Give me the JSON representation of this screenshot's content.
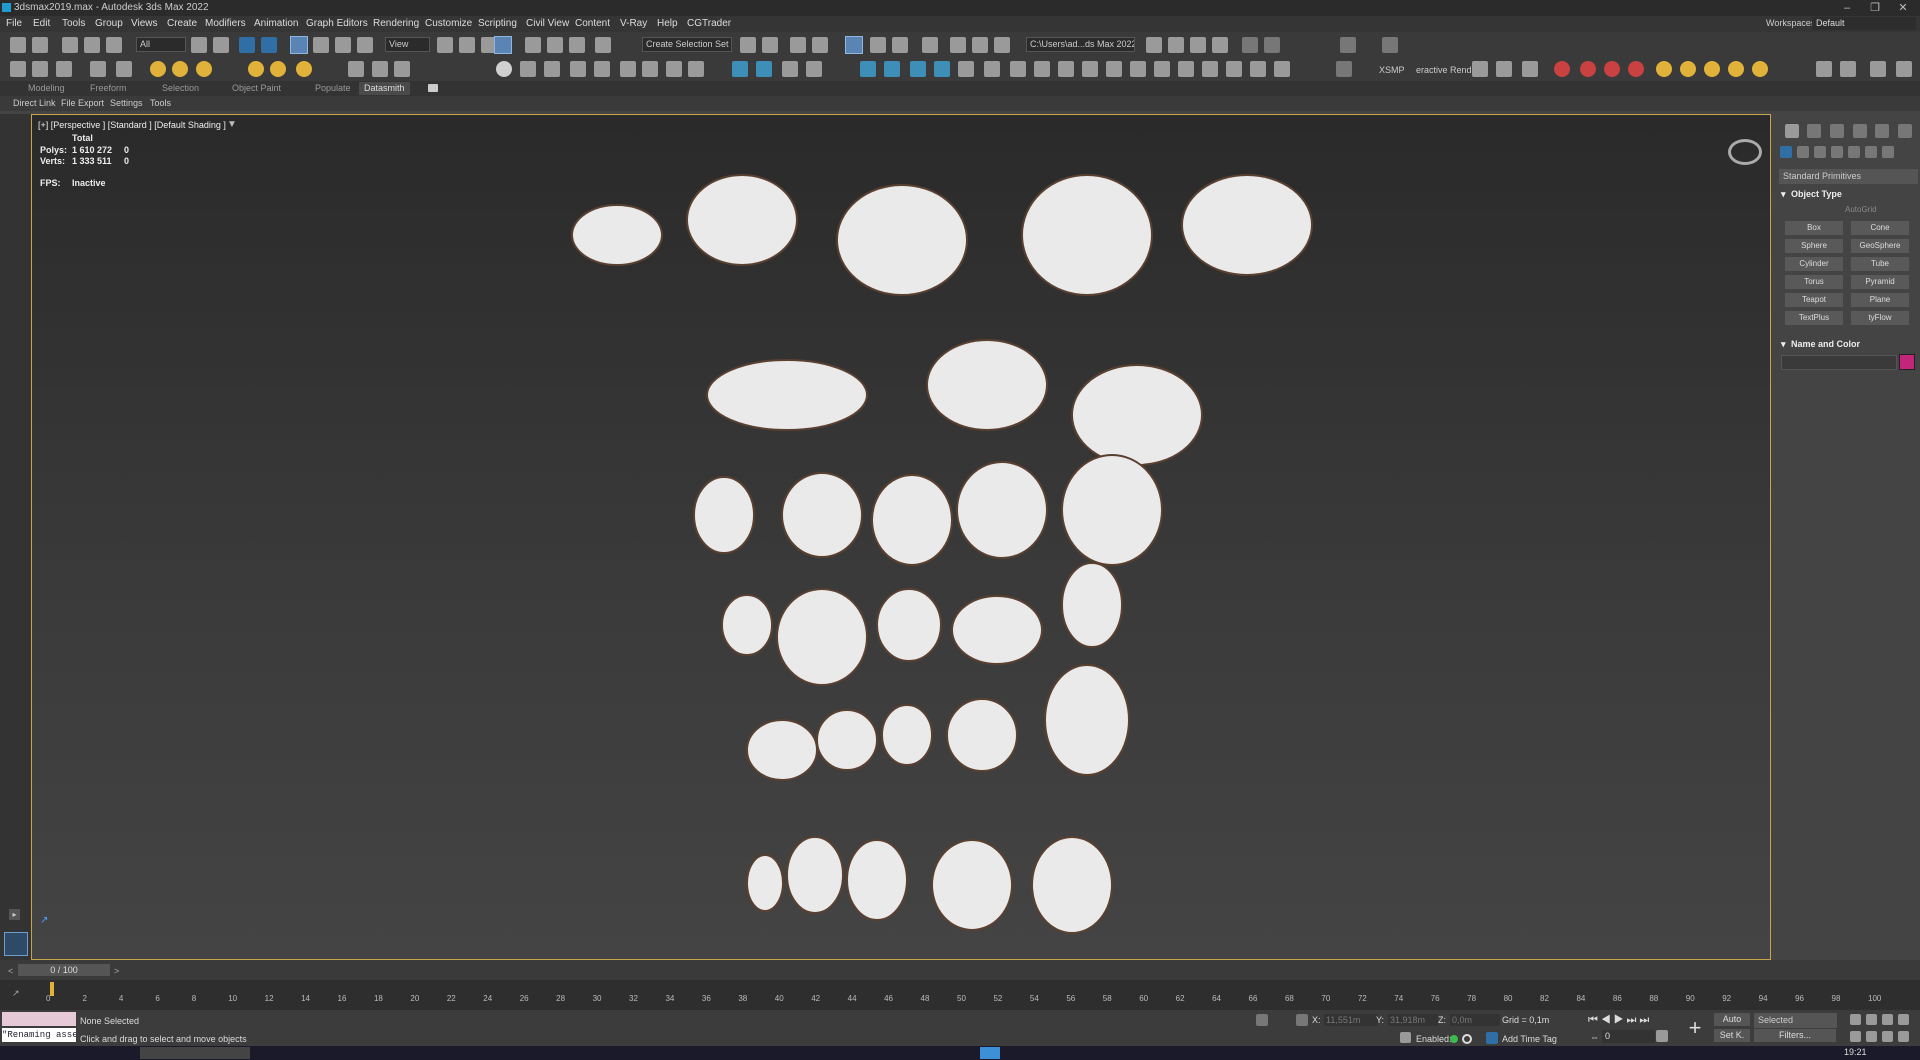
{
  "window": {
    "title": "3dsmax2019.max - Autodesk 3ds Max 2022"
  },
  "menu": {
    "items": [
      "File",
      "Edit",
      "Tools",
      "Group",
      "Views",
      "Create",
      "Modifiers",
      "Animation",
      "Graph Editors",
      "Rendering",
      "Customize",
      "Scripting",
      "Civil View",
      "Content",
      "V-Ray",
      "Help",
      "CGTrader"
    ],
    "workspaces_label": "Workspaces:",
    "workspaces_value": "Default"
  },
  "toolbar": {
    "filter_value": "All",
    "view_value": "View",
    "selection_set_placeholder": "Create Selection Set",
    "project_path": "C:\\Users\\ad...ds Max 2022",
    "xsmp_label": "XSMP",
    "interactive_label": "eractive Rendl"
  },
  "ribbon": {
    "tabs": [
      "Modeling",
      "Freeform",
      "Selection",
      "Object Paint",
      "Populate",
      "Datasmith"
    ],
    "active_tab": "Datasmith"
  },
  "subtabs": [
    "Direct Link",
    "File Export",
    "Settings",
    "Tools"
  ],
  "viewport": {
    "label": "[+] [Perspective ] [Standard ] [Default Shading ]",
    "stats_header": "Total",
    "polys_label": "Polys:",
    "polys_value": "1 610 272",
    "polys_sel": "0",
    "verts_label": "Verts:",
    "verts_value": "1 333 511",
    "verts_sel": "0",
    "fps_label": "FPS:",
    "fps_value": "Inactive"
  },
  "command_panel": {
    "category": "Standard Primitives",
    "object_type_title": "Object Type",
    "autogrid": "AutoGrid",
    "buttons": [
      "Box",
      "Cone",
      "Sphere",
      "GeoSphere",
      "Cylinder",
      "Tube",
      "Torus",
      "Pyramid",
      "Teapot",
      "Plane",
      "TextPlus",
      "tyFlow"
    ],
    "name_color_title": "Name and Color",
    "color_swatch": "#c2257a"
  },
  "timeline": {
    "frame_label": "0 / 100"
  },
  "trackbar": {
    "ticks": [
      "0",
      "2",
      "4",
      "6",
      "8",
      "10",
      "12",
      "14",
      "16",
      "18",
      "20",
      "22",
      "24",
      "26",
      "28",
      "30",
      "32",
      "34",
      "36",
      "38",
      "40",
      "42",
      "44",
      "46",
      "48",
      "50",
      "52",
      "54",
      "56",
      "58",
      "60",
      "62",
      "64",
      "66",
      "68",
      "70",
      "72",
      "74",
      "76",
      "78",
      "80",
      "82",
      "84",
      "86",
      "88",
      "90",
      "92",
      "94",
      "96",
      "98",
      "100"
    ]
  },
  "status": {
    "selection": "None Selected",
    "hint": "Click and drag to select and move objects",
    "script_listener": "\"Renaming asse",
    "x_label": "X:",
    "x_value": "11,551m",
    "y_label": "Y:",
    "y_value": "31,918m",
    "z_label": "Z:",
    "z_value": "0,0m",
    "grid": "Grid = 0,1m",
    "enabled_label": "Enabled:",
    "add_time_tag": "Add Time Tag",
    "auto_label": "Auto",
    "selected_value": "Selected",
    "setk_label": "Set K.",
    "filters_label": "Filters...",
    "frame_value": "0"
  },
  "taskbar": {
    "time": "19:21"
  }
}
